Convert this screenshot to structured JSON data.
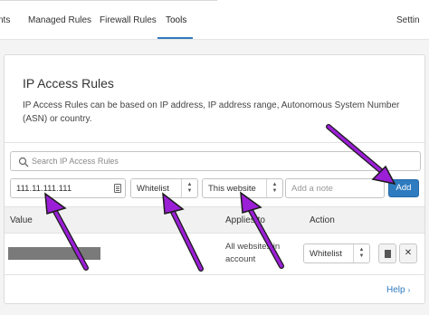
{
  "tabs": [
    {
      "label": "nts"
    },
    {
      "label": "Managed Rules"
    },
    {
      "label": "Firewall Rules"
    },
    {
      "label": "Tools",
      "active": true
    },
    {
      "label": "Settin"
    }
  ],
  "card": {
    "title": "IP Access Rules",
    "description": "IP Access Rules can be based on IP address, IP address range, Autonomous System Number (ASN) or country."
  },
  "search": {
    "placeholder": "Search IP Access Rules"
  },
  "form": {
    "ip_value": "111.11.111.111",
    "mode_value": "Whitelist",
    "scope_value": "This website",
    "note_placeholder": "Add a note",
    "add_label": "Add"
  },
  "table": {
    "headers": {
      "value": "Value",
      "applies_to": "Applies to",
      "action": "Action"
    },
    "rows": [
      {
        "applies_to": "All websites in account",
        "action": "Whitelist"
      }
    ]
  },
  "help_label": "Help",
  "colors": {
    "accent": "#2f7bbf",
    "annotation_arrow": "#9b1fd6"
  },
  "icons": [
    "search-icon",
    "clipboard-icon",
    "chevron-updown-icon",
    "document-icon",
    "close-icon",
    "chevron-right-icon",
    "arrow-annotation"
  ]
}
